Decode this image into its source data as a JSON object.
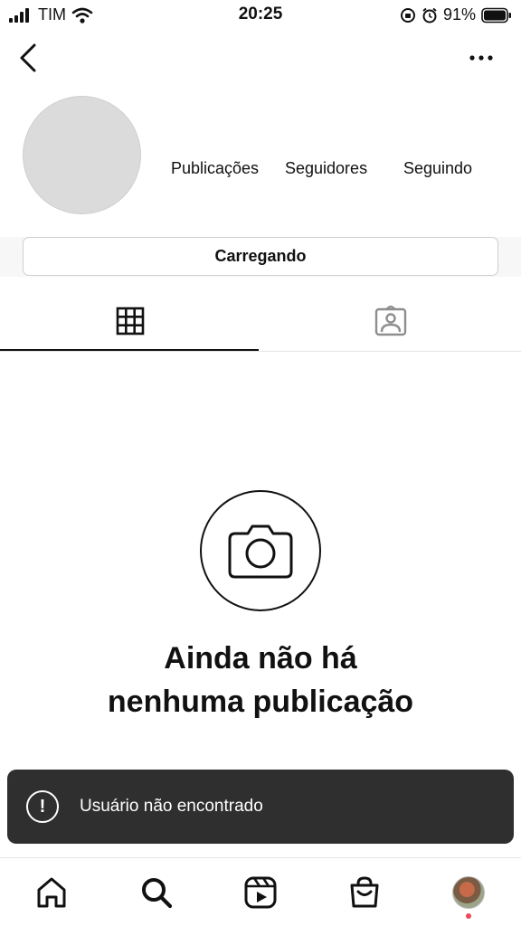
{
  "status_bar": {
    "carrier": "TIM",
    "time": "20:25",
    "battery_percent": "91%",
    "icons": [
      "signal-icon",
      "wifi-icon",
      "orientation-lock-icon",
      "alarm-icon",
      "battery-icon"
    ]
  },
  "nav": {
    "back_icon": "chevron-left-icon",
    "more_icon": "more-horizontal-icon"
  },
  "profile": {
    "stats": {
      "posts_label": "Publicações",
      "followers_label": "Seguidores",
      "following_label": "Seguindo"
    },
    "loading_button_label": "Carregando"
  },
  "tabs": [
    {
      "icon": "grid-icon",
      "active": true
    },
    {
      "icon": "tagged-photos-icon",
      "active": false
    }
  ],
  "empty_state": {
    "icon": "camera-icon",
    "title_line1": "Ainda não há",
    "title_line2": "nenhuma publicação"
  },
  "toast": {
    "icon": "alert-circle-icon",
    "message": "Usuário não encontrado"
  },
  "bottom_nav": {
    "items": [
      "home-icon",
      "search-icon",
      "reels-icon",
      "shop-icon",
      "profile-avatar"
    ],
    "notification_color": "#ed4956"
  },
  "colors": {
    "toast_bg": "#2f2f2f",
    "avatar_placeholder": "#dbdbdb",
    "text": "#111111"
  }
}
